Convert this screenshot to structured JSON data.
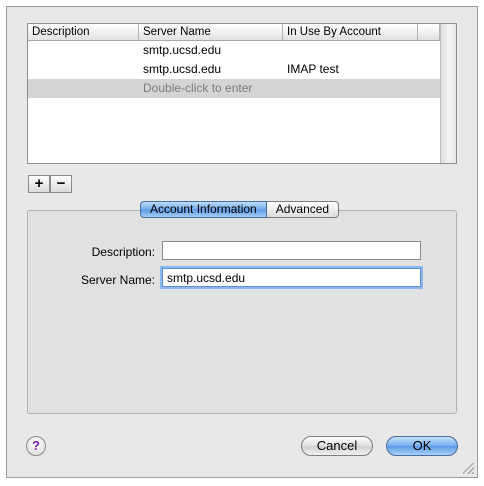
{
  "table": {
    "columns": [
      "Description",
      "Server Name",
      "In Use By Account"
    ],
    "rows": [
      {
        "description": "",
        "server": "smtp.ucsd.edu",
        "inuse": ""
      },
      {
        "description": "",
        "server": "smtp.ucsd.edu",
        "inuse": "IMAP test"
      },
      {
        "description": "",
        "server": "Double-click to enter",
        "inuse": ""
      }
    ]
  },
  "list_buttons": {
    "add": "+",
    "remove": "−"
  },
  "tabs": [
    "Account Information",
    "Advanced"
  ],
  "form": {
    "description_label": "Description:",
    "description_value": "",
    "server_label": "Server Name:",
    "server_value": "smtp.ucsd.edu"
  },
  "buttons": {
    "help": "?",
    "cancel": "Cancel",
    "ok": "OK"
  }
}
